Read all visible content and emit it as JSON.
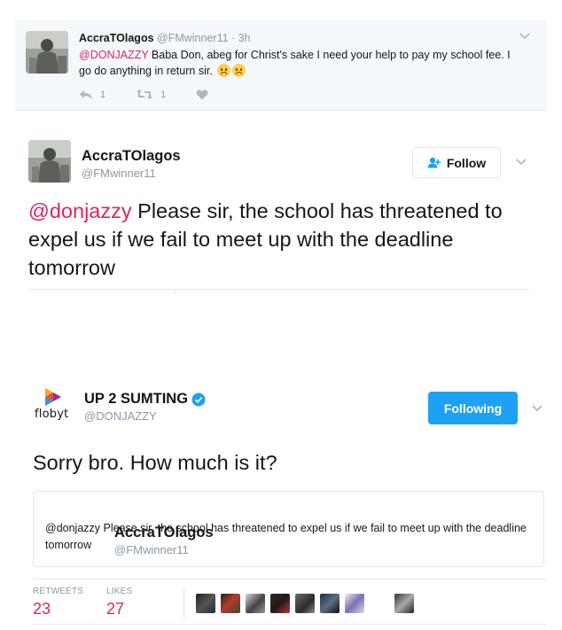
{
  "reply_tweet": {
    "display_name": "AccraTOlagos",
    "handle": "@FMwinner11",
    "time": "· 3h",
    "mention": "@DONJAZZY",
    "text": "Baba Don, abeg for Christ's sake I need your help to pay my school fee. I go do anything in return sir.",
    "emojis": [
      "frowning-face",
      "frowning-face"
    ],
    "reply_count": "1",
    "retweet_count": "1"
  },
  "main_tweet": {
    "display_name": "AccraTOlagos",
    "handle": "@FMwinner11",
    "follow_label": "Follow",
    "mention": "@donjazzy",
    "text": "Please sir, the school has threatened to expel us if we fail to meet up with the deadline tomorrow"
  },
  "response_tweet": {
    "logo_text": "flobyt",
    "display_name": "UP 2 SUMTING",
    "verified": true,
    "handle": "@DONJAZZY",
    "following_label": "Following",
    "text": "Sorry bro. How much is it?",
    "quote": {
      "display_name": "AccraTOlagos",
      "handle": "@FMwinner11",
      "text": "@donjazzy Please sir, the school has threatened to expel us if we fail to meet up with the deadline tomorrow"
    },
    "stats": {
      "retweets_label": "RETWEETS",
      "retweets_value": "23",
      "likes_label": "LIKES",
      "likes_value": "27"
    }
  },
  "colors": {
    "accent": "#1da1f2",
    "mention": "#e0245e",
    "muted": "#8899a6",
    "reply_bg": "#f5f8fa"
  },
  "icons": [
    "reply-icon",
    "retweet-icon",
    "heart-icon",
    "chevron-down-icon",
    "follow-person-icon",
    "verified-badge-icon"
  ]
}
